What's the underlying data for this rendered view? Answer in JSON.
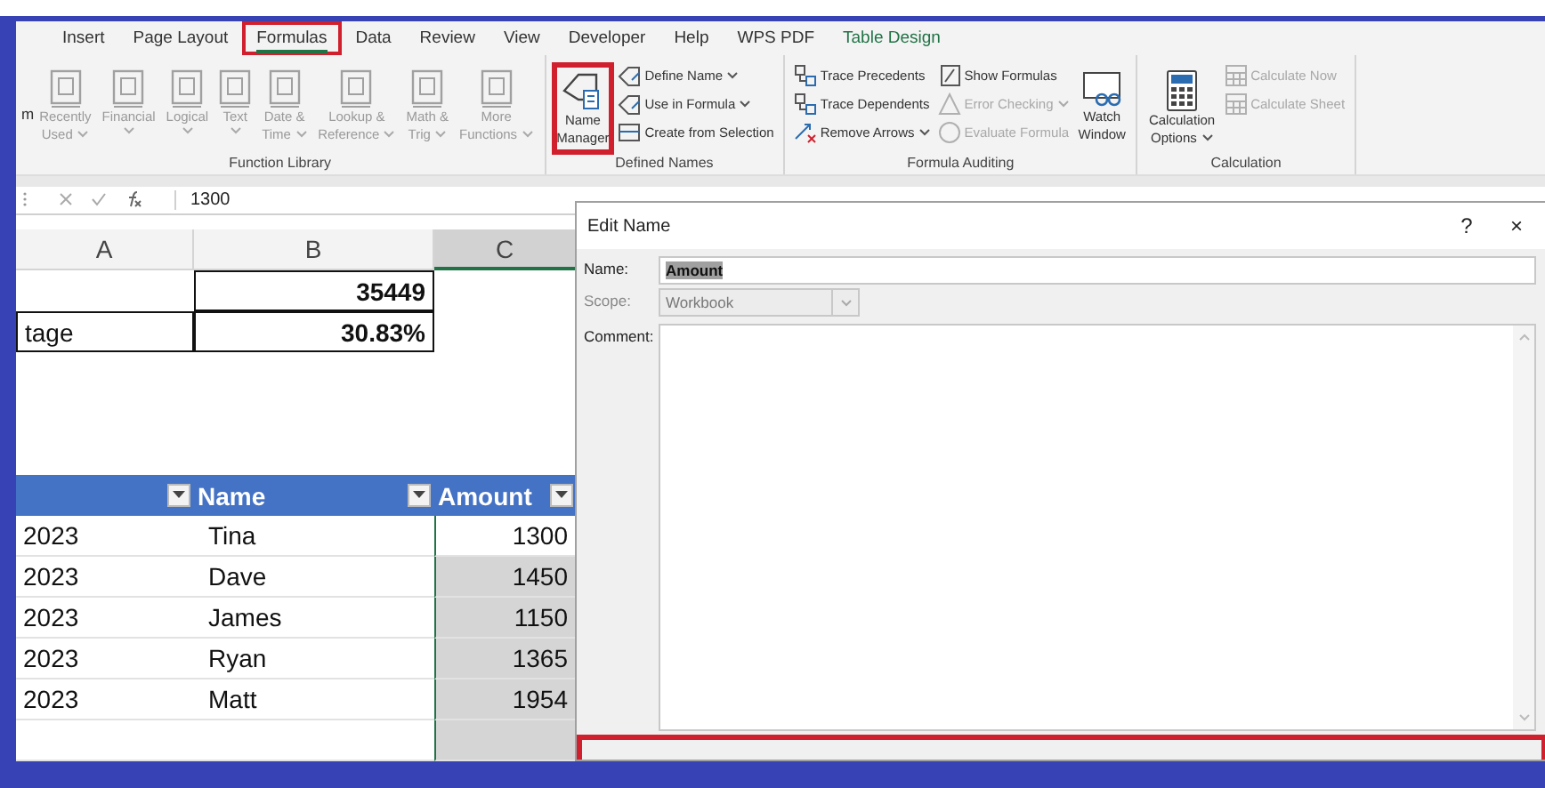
{
  "ribbon_tabs": [
    {
      "label": "Insert",
      "selected": false,
      "highlighted": false,
      "kind": "standard"
    },
    {
      "label": "Page Layout",
      "selected": false,
      "highlighted": false,
      "kind": "standard"
    },
    {
      "label": "Formulas",
      "selected": true,
      "highlighted": true,
      "kind": "standard"
    },
    {
      "label": "Data",
      "selected": false,
      "highlighted": false,
      "kind": "standard"
    },
    {
      "label": "Review",
      "selected": false,
      "highlighted": false,
      "kind": "standard"
    },
    {
      "label": "View",
      "selected": false,
      "highlighted": false,
      "kind": "standard"
    },
    {
      "label": "Developer",
      "selected": false,
      "highlighted": false,
      "kind": "standard"
    },
    {
      "label": "Help",
      "selected": false,
      "highlighted": false,
      "kind": "standard"
    },
    {
      "label": "WPS PDF",
      "selected": false,
      "highlighted": false,
      "kind": "standard"
    },
    {
      "label": "Table Design",
      "selected": false,
      "highlighted": false,
      "kind": "contextual"
    }
  ],
  "ribbon_groups": [
    {
      "title": "Function Library",
      "leading_text": "m",
      "items": [
        {
          "kind": "large",
          "lines": [
            "Recently",
            "Used"
          ],
          "dropdown": true,
          "disabled": true,
          "highlighted": false
        },
        {
          "kind": "large",
          "lines": [
            "Financial"
          ],
          "dropdown": true,
          "disabled": true,
          "highlighted": false
        },
        {
          "kind": "large",
          "lines": [
            "Logical"
          ],
          "dropdown": true,
          "disabled": true,
          "highlighted": false
        },
        {
          "kind": "large",
          "lines": [
            "Text"
          ],
          "dropdown": true,
          "disabled": true,
          "highlighted": false
        },
        {
          "kind": "large",
          "lines": [
            "Date &",
            "Time"
          ],
          "dropdown": true,
          "disabled": true,
          "highlighted": false
        },
        {
          "kind": "large",
          "lines": [
            "Lookup &",
            "Reference"
          ],
          "dropdown": true,
          "disabled": true,
          "highlighted": false
        },
        {
          "kind": "large",
          "lines": [
            "Math &",
            "Trig"
          ],
          "dropdown": true,
          "disabled": true,
          "highlighted": false
        },
        {
          "kind": "large",
          "lines": [
            "More",
            "Functions"
          ],
          "dropdown": true,
          "disabled": true,
          "highlighted": false
        }
      ]
    },
    {
      "title": "Defined Names",
      "items": [
        {
          "kind": "large",
          "lines": [
            "Name",
            "Manager"
          ],
          "dropdown": false,
          "disabled": false,
          "highlighted": true
        },
        {
          "kind": "stack",
          "buttons": [
            {
              "label": "Define Name",
              "dropdown": true,
              "disabled": false
            },
            {
              "label": "Use in Formula",
              "dropdown": true,
              "disabled": false
            },
            {
              "label": "Create from Selection",
              "dropdown": false,
              "disabled": false
            }
          ]
        }
      ]
    },
    {
      "title": "Formula Auditing",
      "items": [
        {
          "kind": "stack",
          "buttons": [
            {
              "label": "Trace Precedents",
              "dropdown": false,
              "disabled": false
            },
            {
              "label": "Trace Dependents",
              "dropdown": false,
              "disabled": false
            },
            {
              "label": "Remove Arrows",
              "dropdown": true,
              "disabled": false
            }
          ]
        },
        {
          "kind": "stack",
          "buttons": [
            {
              "label": "Show Formulas",
              "dropdown": false,
              "disabled": false
            },
            {
              "label": "Error Checking",
              "dropdown": true,
              "disabled": true
            },
            {
              "label": "Evaluate Formula",
              "dropdown": false,
              "disabled": true
            }
          ]
        },
        {
          "kind": "large",
          "lines": [
            "Watch",
            "Window"
          ],
          "dropdown": false,
          "disabled": false,
          "highlighted": false
        }
      ]
    },
    {
      "title": "Calculation",
      "items": [
        {
          "kind": "large",
          "lines": [
            "Calculation",
            "Options"
          ],
          "dropdown": true,
          "disabled": false,
          "highlighted": false
        },
        {
          "kind": "stack",
          "buttons": [
            {
              "label": "Calculate Now",
              "dropdown": false,
              "disabled": true
            },
            {
              "label": "Calculate Sheet",
              "dropdown": false,
              "disabled": true
            }
          ]
        }
      ]
    }
  ],
  "formula_bar": {
    "value": "1300"
  },
  "sheet": {
    "columns": [
      {
        "label": "A",
        "selected": false
      },
      {
        "label": "B",
        "selected": false
      },
      {
        "label": "C",
        "selected": true
      }
    ],
    "summary_rows": [
      {
        "label": "",
        "value": "35449"
      },
      {
        "label": "tage",
        "value": "30.83%"
      }
    ],
    "table": {
      "columns": [
        "",
        "Name",
        "Amount"
      ],
      "rows": [
        {
          "date": "2023",
          "name": "Tina",
          "amount": "1300",
          "active": true
        },
        {
          "date": "2023",
          "name": "Dave",
          "amount": "1450",
          "active": false
        },
        {
          "date": "2023",
          "name": "James",
          "amount": "1150",
          "active": false
        },
        {
          "date": "2023",
          "name": "Ryan",
          "amount": "1365",
          "active": false
        },
        {
          "date": "2023",
          "name": "Matt",
          "amount": "1954",
          "active": false
        }
      ]
    }
  },
  "dialog": {
    "title": "Edit Name",
    "help": "?",
    "close": "×",
    "name_label": "Name:",
    "name_value": "Amount",
    "scope_label": "Scope:",
    "scope_value": "Workbook",
    "scope_disabled": true,
    "comment_label": "Comment:",
    "footer_highlighted": true
  }
}
